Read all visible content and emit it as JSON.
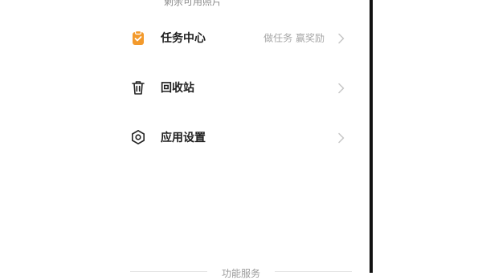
{
  "top_partial_text": "剩余可用照片",
  "menu": [
    {
      "label": "任务中心",
      "hint": "做任务 赢奖励",
      "icon": "task-clipboard-icon"
    },
    {
      "label": "回收站",
      "hint": "",
      "icon": "trash-icon"
    },
    {
      "label": "应用设置",
      "hint": "",
      "icon": "settings-hexagon-icon"
    }
  ],
  "section": {
    "title": "功能服务"
  },
  "colors": {
    "accent": "#f39a2c",
    "text": "#1e1e1e",
    "hint": "#a6a6a6",
    "chevron": "#c6c6c6"
  }
}
